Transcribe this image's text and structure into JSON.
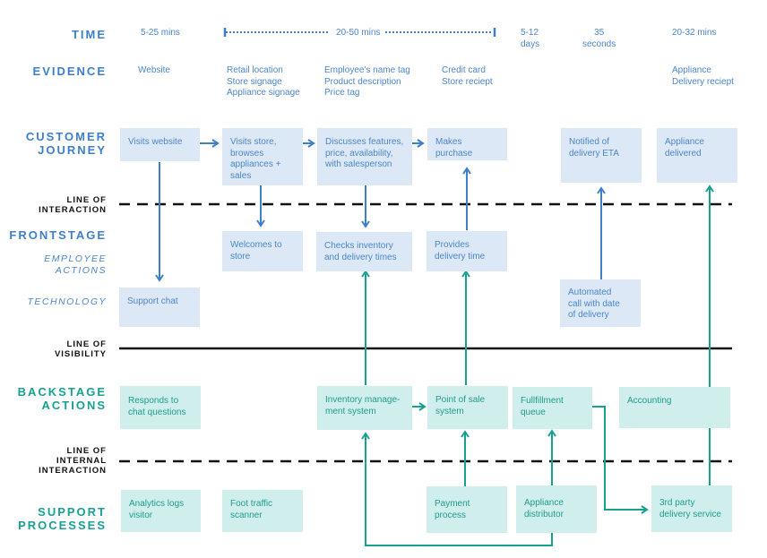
{
  "lanes": {
    "time": "TIME",
    "evidence": "EVIDENCE",
    "customer_journey": [
      "CUSTOMER",
      "JOURNEY"
    ],
    "line_of_interaction": [
      "LINE OF",
      "INTERACTION"
    ],
    "frontstage": "FRONTSTAGE",
    "employee_actions": [
      "EMPLOYEE",
      "ACTIONS"
    ],
    "technology": "TECHNOLOGY",
    "line_of_visibility": [
      "LINE OF",
      "VISIBILITY"
    ],
    "backstage_actions": [
      "BACKSTAGE",
      "ACTIONS"
    ],
    "line_of_internal_interaction": [
      "LINE OF",
      "INTERNAL",
      "INTERACTION"
    ],
    "support_processes": [
      "SUPPORT",
      "PROCESSES"
    ]
  },
  "time": [
    [
      "5-25 mins"
    ],
    [
      "20-50 mins"
    ],
    [
      "5-12",
      "days"
    ],
    [
      "35",
      "seconds"
    ],
    [
      "20-32 mins"
    ]
  ],
  "evidence": [
    [
      "Website"
    ],
    [
      "Retail location",
      "Store signage",
      "Appliance signage"
    ],
    [
      "Employee's name tag",
      "Product description",
      "Price tag"
    ],
    [
      "Credit card",
      "Store reciept"
    ],
    [
      "Appliance",
      "Delivery reciept"
    ]
  ],
  "customer_journey": [
    [
      "Visits website"
    ],
    [
      "Visits store,",
      "browses",
      "appliances +",
      "sales"
    ],
    [
      "Discusses features,",
      "price, availability,",
      "with salesperson"
    ],
    [
      "Makes purchase"
    ],
    [
      "Notified of",
      "delivery ETA"
    ],
    [
      "Appliance",
      "delivered"
    ]
  ],
  "employee_actions": [
    [
      "Welcomes to",
      "store"
    ],
    [
      "Checks inventory",
      "and delivery times"
    ],
    [
      "Provides",
      "delivery time"
    ]
  ],
  "technology": [
    [
      "Support chat"
    ],
    [
      "Automated",
      "call with date",
      "of delivery"
    ]
  ],
  "backstage": [
    [
      "Responds to",
      "chat questions"
    ],
    [
      "Inventory manage-",
      "ment system"
    ],
    [
      "Point of sale",
      "system"
    ],
    [
      "Fullfillment",
      "queue"
    ],
    [
      "Accounting"
    ]
  ],
  "support": [
    [
      "Analytics logs",
      "visitor"
    ],
    [
      "Foot traffic",
      "scanner"
    ],
    [
      "Payment",
      "process"
    ],
    [
      "Appliance",
      "distributor"
    ],
    [
      "3rd party",
      "delivery service"
    ]
  ],
  "colors": {
    "blue": "#3d7fc9",
    "teal": "#17a192",
    "blue_box": "#dce8f5",
    "teal_box": "#d0eeeb"
  }
}
